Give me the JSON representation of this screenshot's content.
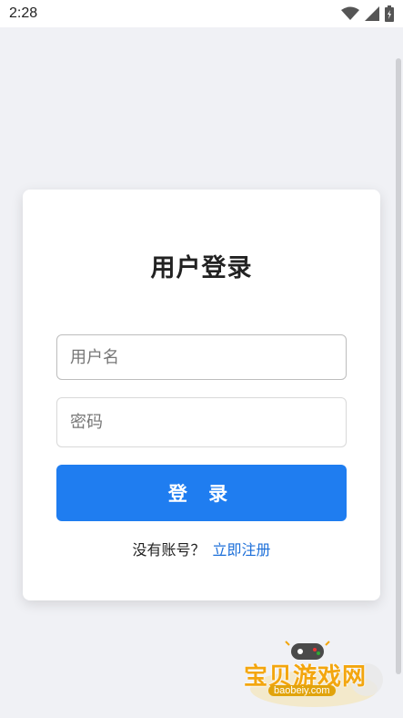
{
  "status_bar": {
    "time": "2:28",
    "icons": [
      "wifi-icon",
      "signal-icon",
      "battery-icon"
    ]
  },
  "login": {
    "title": "用户登录",
    "username_placeholder": "用户名",
    "password_placeholder": "密码",
    "submit_label": "登 录",
    "no_account_text": "没有账号？",
    "register_link": "立即注册"
  },
  "watermark": {
    "text": "宝贝游戏网",
    "url": "baobeiy.com"
  },
  "colors": {
    "background": "#f0f1f5",
    "card": "#ffffff",
    "primary_button": "#1f7df0",
    "link": "#1c6fd9",
    "watermark": "#f3a60e"
  }
}
